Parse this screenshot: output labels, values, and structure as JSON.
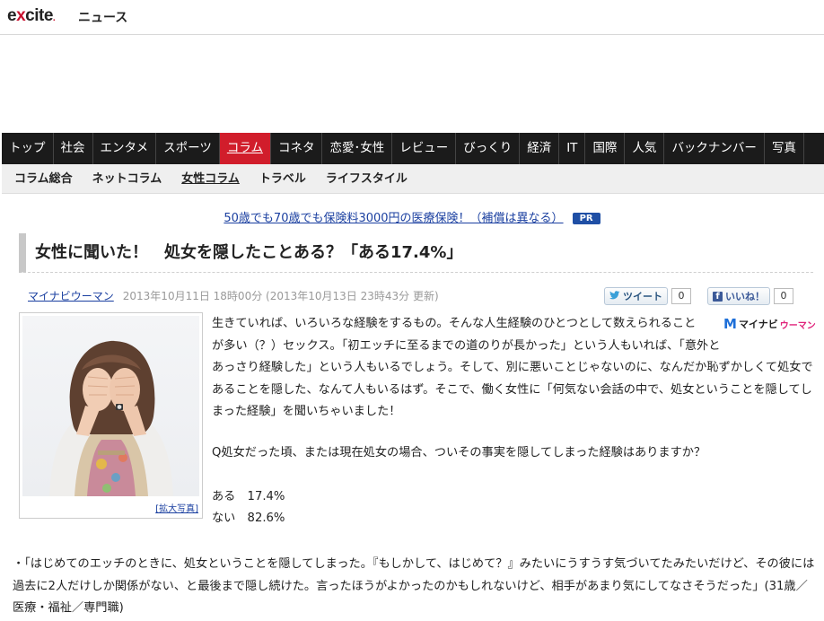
{
  "header": {
    "logo_text_a": "e",
    "logo_text_x": "x",
    "logo_text_b": "cite",
    "logo_dot": ".",
    "logo_sub": "ニュース"
  },
  "main_nav": [
    {
      "label": "トップ"
    },
    {
      "label": "社会"
    },
    {
      "label": "エンタメ"
    },
    {
      "label": "スポーツ"
    },
    {
      "label": "コラム",
      "active": true
    },
    {
      "label": "コネタ"
    },
    {
      "label": "恋愛･女性"
    },
    {
      "label": "レビュー"
    },
    {
      "label": "びっくり"
    },
    {
      "label": "経済"
    },
    {
      "label": "IT"
    },
    {
      "label": "国際"
    },
    {
      "label": "人気"
    },
    {
      "label": "バックナンバー"
    },
    {
      "label": "写真"
    }
  ],
  "sub_nav": [
    {
      "label": "コラム総合"
    },
    {
      "label": "ネットコラム"
    },
    {
      "label": "女性コラム",
      "active": true
    },
    {
      "label": "トラベル"
    },
    {
      "label": "ライフスタイル"
    }
  ],
  "promo": {
    "link_text": "50歳でも70歳でも保険料3000円の医療保険！（補償は異なる）",
    "badge": "PR"
  },
  "article": {
    "title": "女性に聞いた！　処女を隠したことある？「ある17.4%」",
    "author": "マイナビウーマン",
    "date": "2013年10月11日 18時00分 (2013年10月13日 23時43分 更新)",
    "enlarge_label": "[拡大写真]",
    "brand_m": "M",
    "brand_name": "マイナビ",
    "brand_sub": "ウーマン",
    "intro_line1": "生きていれば、いろいろな経験をするもの。そんな人生経験のひとつとして数えられること",
    "intro_line2": "が多い（？）セックス。「初エッチに至るまでの道のりが長かった」という人もいれば、「意外と",
    "intro_rest": "あっさり経験した」という人もいるでしょう。そして、別に悪いことじゃないのに、なんだか恥ずかしくて処女であることを隠した、なんて人もいるはず。そこで、働く女性に「何気ない会話の中で、処女ということを隠してしまった経験」を聞いちゃいました！",
    "question": "Q処女だった頃、または現在処女の場合、ついその事実を隠してしまった経験はありますか？",
    "answer_yes": "ある　17.4%",
    "answer_no": "ない　82.6%",
    "quote": "・「はじめてのエッチのときに、処女ということを隠してしまった。『もしかして、はじめて？』みたいにうすうす気づいてたみたいだけど、その彼には過去に2人だけしか関係がない、と最後まで隠し続けた。言ったほうがよかったのかもしれないけど、相手があまり気にしてなさそうだった」(31歳／医療・福祉／専門職)"
  },
  "social": {
    "tweet_label": "ツイート",
    "tweet_count": "0",
    "like_label": "いいね！",
    "like_count": "0"
  },
  "colors": {
    "nav_bg": "#1b1b1b",
    "nav_active": "#d11d2b",
    "link": "#1a3fa0",
    "pr_badge": "#1f4fa5"
  }
}
